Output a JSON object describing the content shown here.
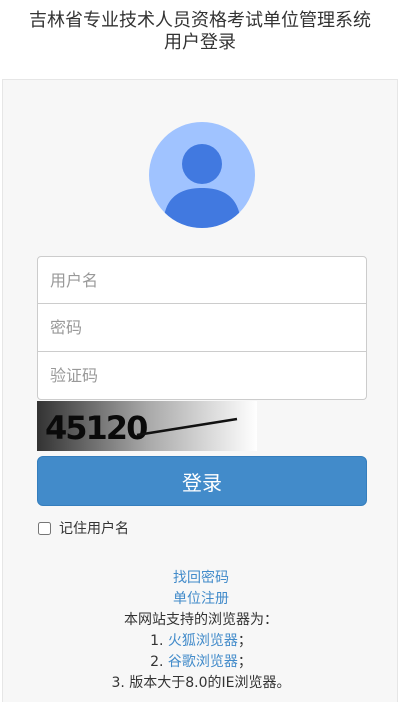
{
  "page": {
    "title_line1": "吉林省专业技术人员资格考试单位管理系统",
    "title_line2": "用户登录"
  },
  "form": {
    "username_placeholder": "用户名",
    "password_placeholder": "密码",
    "captcha_placeholder": "验证码",
    "captcha_text": "45120",
    "login_label": "登录",
    "remember_label": "记住用户名"
  },
  "links": {
    "forgot_password": "找回密码",
    "register": "单位注册"
  },
  "browser_note": {
    "intro": "本网站支持的浏览器为：",
    "item1_prefix": "1. ",
    "item1_link": "火狐浏览器",
    "item1_suffix": "；",
    "item2_prefix": "2. ",
    "item2_link": "谷歌浏览器",
    "item2_suffix": "；",
    "item3": "3. 版本大于8.0的IE浏览器。"
  },
  "colors": {
    "primary": "#428bca",
    "avatar_bg": "#a0c3ff",
    "avatar_fg": "#4179e0",
    "panel_bg": "#f7f7f7"
  }
}
